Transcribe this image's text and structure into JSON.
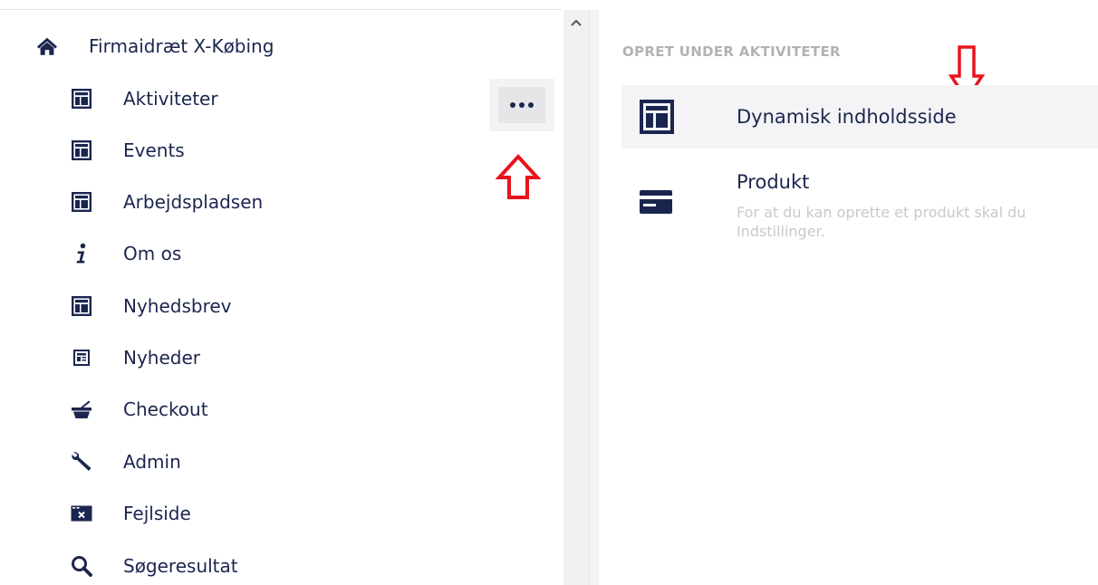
{
  "tree": {
    "root": {
      "label": "Firmaidræt X-Købing",
      "icon": "home-icon"
    },
    "items": [
      {
        "label": "Aktiviteter",
        "icon": "page-layout-icon"
      },
      {
        "label": "Events",
        "icon": "page-layout-icon"
      },
      {
        "label": "Arbejdspladsen",
        "icon": "page-layout-icon"
      },
      {
        "label": "Om os",
        "icon": "info-icon"
      },
      {
        "label": "Nyhedsbrev",
        "icon": "page-layout-icon"
      },
      {
        "label": "Nyheder",
        "icon": "newspaper-icon"
      },
      {
        "label": "Checkout",
        "icon": "basket-icon"
      },
      {
        "label": "Admin",
        "icon": "wrench-icon"
      },
      {
        "label": "Fejlside",
        "icon": "error-page-icon"
      },
      {
        "label": "Søgeresultat",
        "icon": "search-icon"
      }
    ],
    "actions_icon": "more-dots-icon"
  },
  "panel": {
    "title": "OPRET UNDER AKTIVITETER",
    "options": [
      {
        "label": "Dynamisk indholdsside",
        "icon": "page-layout-icon",
        "description": ""
      },
      {
        "label": "Produkt",
        "icon": "credit-card-icon",
        "description": "For at du kan oprette et produkt skal du Indstillinger."
      }
    ]
  },
  "colors": {
    "text": "#1b264f",
    "muted": "#b2b2b6",
    "highlight": "#f4f4f6",
    "annotation": "#e8141c"
  }
}
